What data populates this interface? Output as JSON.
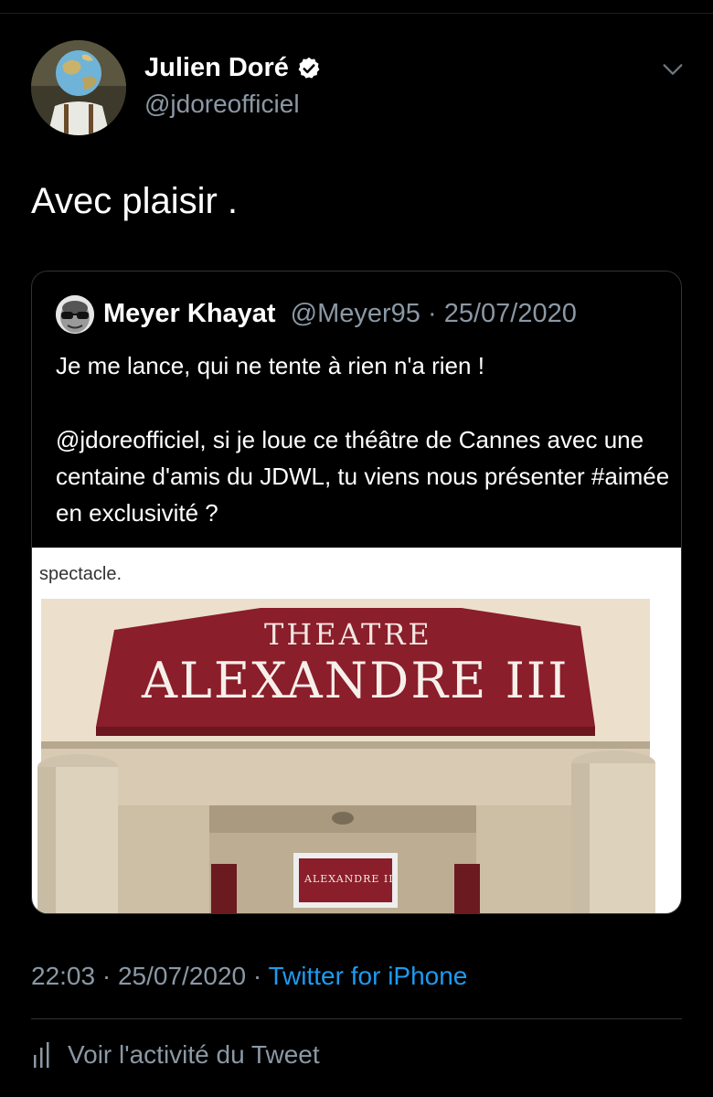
{
  "author": {
    "display_name": "Julien Doré",
    "handle": "@jdoreofficiel",
    "verified_icon": "verified-badge-icon"
  },
  "tweet": {
    "text": "Avec plaisir ."
  },
  "quoted_tweet": {
    "display_name": "Meyer Khayat",
    "handle": "@Meyer95",
    "separator": " · ",
    "date": "25/07/2020",
    "line1": "Je me lance, qui ne tente à rien n'a rien !",
    "paragraph": "@jdoreofficiel, si je loue ce théâtre de Cannes avec une centaine d'amis du JDWL, tu viens nous présenter #aimée en exclusivité ?",
    "image": {
      "caption": "spectacle.",
      "sign_line1": "THEATRE",
      "sign_line2": "ALEXANDRE III",
      "small_sign": "ALEXANDRE III"
    }
  },
  "meta": {
    "time": "22:03",
    "separator": " · ",
    "date": "25/07/2020",
    "source": "Twitter for iPhone"
  },
  "activity": {
    "label": "Voir l'activité du Tweet",
    "icon": "activity-bars-icon"
  },
  "colors": {
    "background": "#000000",
    "secondary_text": "#8b98a5",
    "link": "#1d9bf0",
    "verified": "#ffffff",
    "sign_red": "#8a1e2a"
  }
}
